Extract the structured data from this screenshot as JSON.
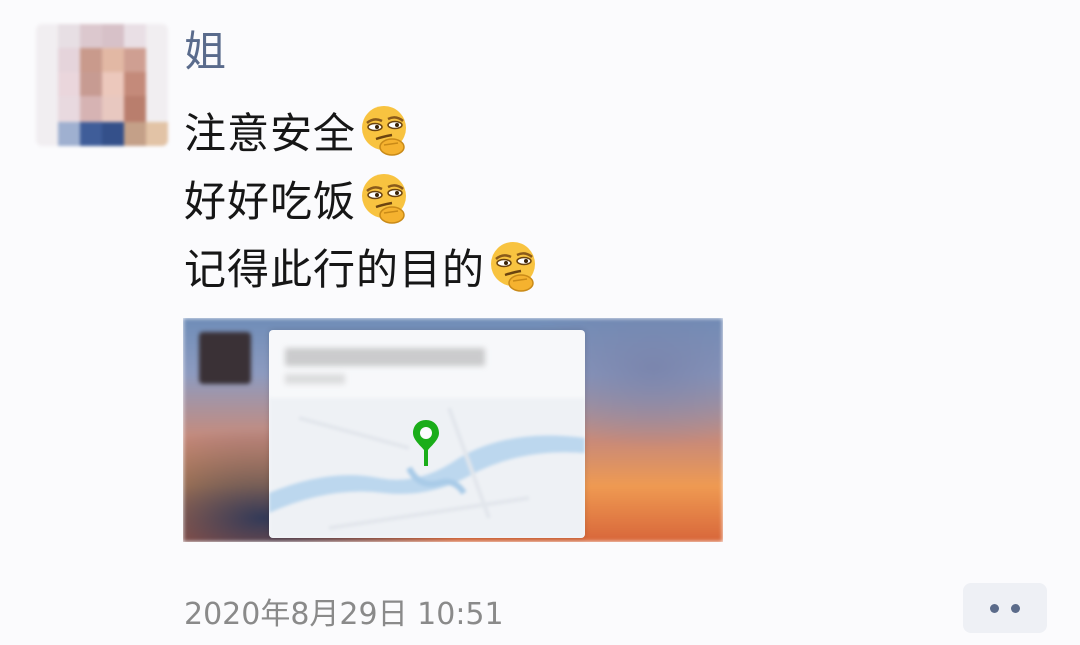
{
  "message": {
    "sender": "姐",
    "lines": [
      {
        "text": "注意安全",
        "emoji": "smirk-emoji"
      },
      {
        "text": "好好吃饭",
        "emoji": "smirk-emoji"
      },
      {
        "text": "记得此行的目的",
        "emoji": "smirk-emoji"
      }
    ],
    "attachment": {
      "type": "location-card",
      "icon": "map-pin-icon",
      "pin_color": "#1aad19"
    },
    "timestamp": "2020年8月29日 10:51"
  },
  "actions": {
    "more_icon": "more-dots-icon"
  },
  "colors": {
    "background": "#fbfbfd",
    "sender_name": "#5a6b8c",
    "timestamp": "#8a8a8a",
    "more_button_bg": "#eef0f5"
  }
}
